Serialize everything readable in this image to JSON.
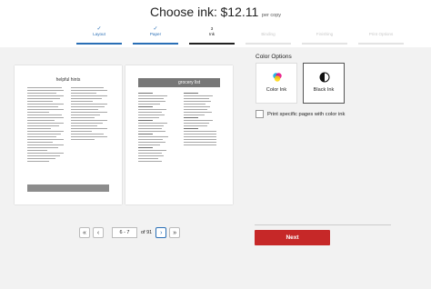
{
  "header": {
    "title_prefix": "Choose ink:",
    "price": "$12.11",
    "price_unit": "per copy"
  },
  "steps": [
    {
      "num": "✓",
      "label": "Layout",
      "state": "done"
    },
    {
      "num": "✓",
      "label": "Paper",
      "state": "done"
    },
    {
      "num": "3",
      "label": "Ink",
      "state": "current"
    },
    {
      "num": "",
      "label": "Binding",
      "state": "todo"
    },
    {
      "num": "",
      "label": "Finishing",
      "state": "todo"
    },
    {
      "num": "",
      "label": "Print Options",
      "state": "todo"
    }
  ],
  "preview": {
    "left_page_title": "helpful hints",
    "right_page_title": "grocery list"
  },
  "pager": {
    "first": "«",
    "prev": "‹",
    "current_pages": "6 - 7",
    "of_label": "of 91",
    "next": "›",
    "last": "»"
  },
  "options": {
    "title": "Color Options",
    "color_label": "Color Ink",
    "black_label": "Black Ink",
    "selected": "Black Ink",
    "print_specific_label": "Print specific pages with color ink"
  },
  "actions": {
    "next_label": "Next"
  },
  "colors": {
    "accent": "#2a6fb6",
    "next_button": "#c62828"
  }
}
